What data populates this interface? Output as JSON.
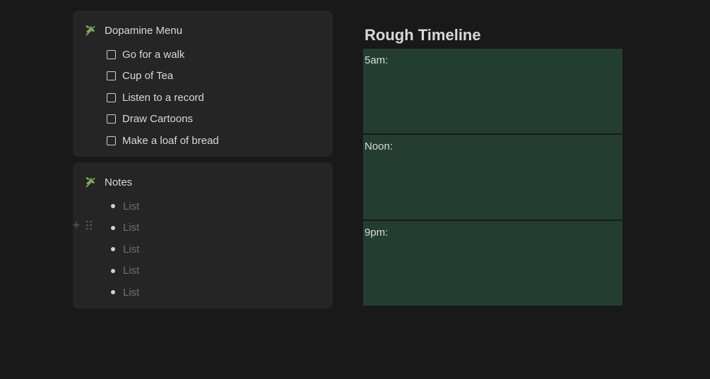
{
  "dopamine_menu": {
    "title": "Dopamine Menu",
    "icon": "leaf-icon",
    "items": [
      {
        "label": "Go for a walk",
        "checked": false
      },
      {
        "label": "Cup of Tea",
        "checked": false
      },
      {
        "label": "Listen to a record",
        "checked": false
      },
      {
        "label": "Draw Cartoons",
        "checked": false
      },
      {
        "label": "Make a loaf of bread",
        "checked": false
      }
    ]
  },
  "notes": {
    "title": "Notes",
    "icon": "leaf-icon",
    "items": [
      {
        "placeholder": "List"
      },
      {
        "placeholder": "List"
      },
      {
        "placeholder": "List"
      },
      {
        "placeholder": "List"
      },
      {
        "placeholder": "List"
      }
    ]
  },
  "timeline": {
    "title": "Rough Timeline",
    "slots": [
      {
        "label": "5am:"
      },
      {
        "label": "Noon:"
      },
      {
        "label": "9pm:"
      }
    ]
  },
  "colors": {
    "background": "#191919",
    "callout_bg": "#252525",
    "slot_bg": "#243d32",
    "leaf": "#7fb35a"
  }
}
